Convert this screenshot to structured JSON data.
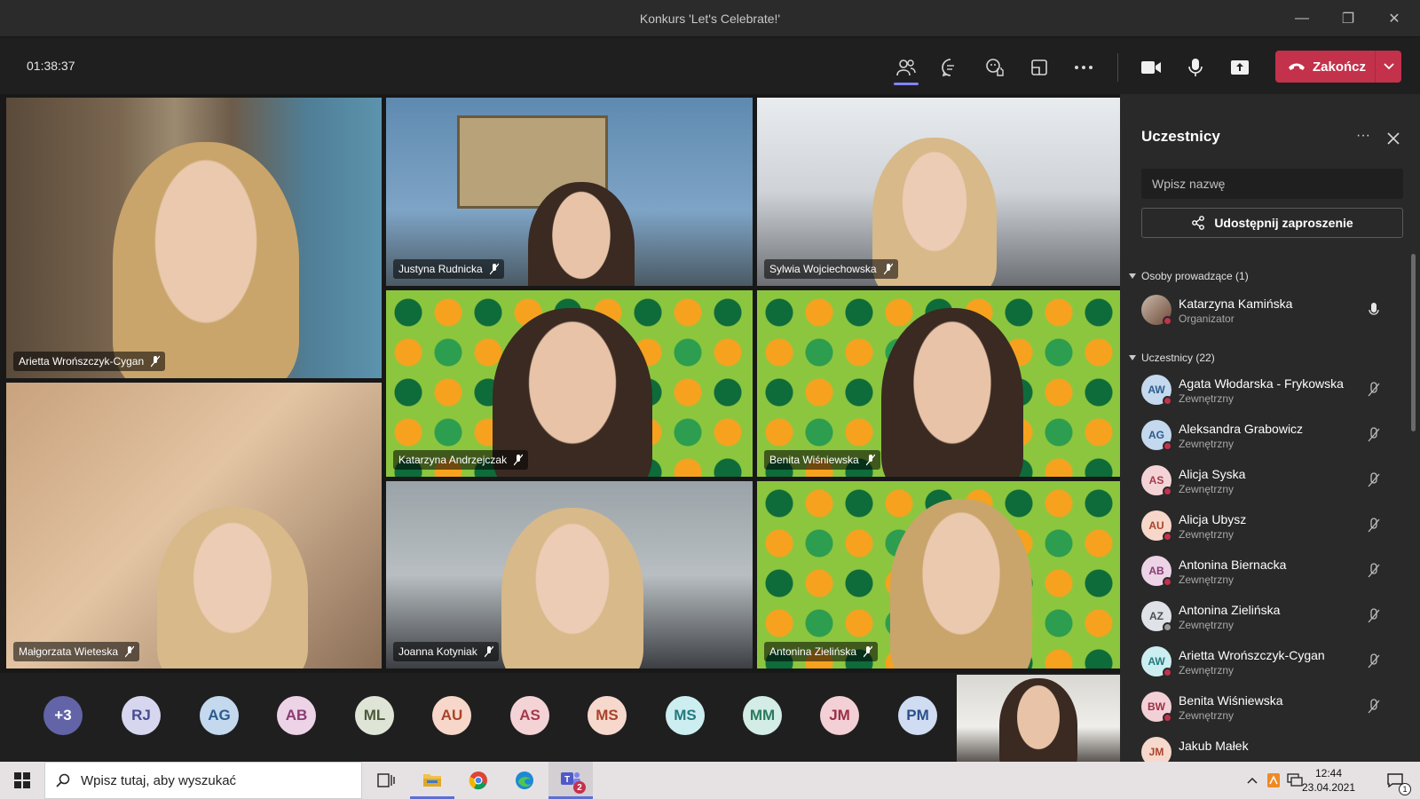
{
  "window": {
    "title": "Konkurs 'Let's Celebrate!'",
    "minimize": "—",
    "restore": "❐",
    "close": "✕"
  },
  "toolbar": {
    "timer": "01:38:37",
    "end_label": "Zakończ"
  },
  "tiles": [
    {
      "name": "Arietta Wrońszczyk-Cygan"
    },
    {
      "name": "Justyna Rudnicka"
    },
    {
      "name": "Sylwia Wojciechowska"
    },
    {
      "name": "Katarzyna Andrzejczak"
    },
    {
      "name": "Benita Wiśniewska"
    },
    {
      "name": "Małgorzata Wieteska"
    },
    {
      "name": "Joanna Kotyniak"
    },
    {
      "name": "Antonina Zielińska"
    }
  ],
  "strip": {
    "overflow": "+3",
    "avatars": [
      "RJ",
      "AG",
      "AB",
      "ML",
      "AU",
      "AS",
      "MS",
      "MS",
      "MM",
      "JM",
      "PM"
    ]
  },
  "panel": {
    "title": "Uczestnicy",
    "more": "···",
    "search_placeholder": "Wpisz nazwę",
    "share_label": "Udostępnij zaproszenie",
    "presenters_section": "Osoby prowadzące (1)",
    "attendees_section": "Uczestnicy (22)",
    "presenter": {
      "name": "Katarzyna Kamińska",
      "role": "Organizator"
    },
    "attendees": [
      {
        "initials": "AW",
        "name": "Agata Włodarska - Frykowska",
        "role": "Zewnętrzny"
      },
      {
        "initials": "AG",
        "name": "Aleksandra Grabowicz",
        "role": "Zewnętrzny"
      },
      {
        "initials": "AS",
        "name": "Alicja Syska",
        "role": "Zewnętrzny"
      },
      {
        "initials": "AU",
        "name": "Alicja Ubysz",
        "role": "Zewnętrzny"
      },
      {
        "initials": "AB",
        "name": "Antonina Biernacka",
        "role": "Zewnętrzny"
      },
      {
        "initials": "AZ",
        "name": "Antonina Zielińska",
        "role": "Zewnętrzny"
      },
      {
        "initials": "AW",
        "name": "Arietta Wrońszczyk-Cygan",
        "role": "Zewnętrzny"
      },
      {
        "initials": "BW",
        "name": "Benita Wiśniewska",
        "role": "Zewnętrzny"
      },
      {
        "initials": "JM",
        "name": "Jakub Małek",
        "role": ""
      }
    ]
  },
  "taskbar": {
    "search_placeholder": "Wpisz tutaj, aby wyszukać",
    "time": "12:44",
    "date": "23.04.2021",
    "teams_badge": "2",
    "notif_badge": "1"
  },
  "colors": {
    "accent": "#7f85f5",
    "end_call": "#c4314b",
    "panel_bg": "#292929",
    "taskbar_bg": "#e6e2e4"
  },
  "icons": [
    "people-icon",
    "chat-icon",
    "raise-hand-icon",
    "rooms-icon",
    "more-icon",
    "camera-icon",
    "mic-icon",
    "share-screen-icon",
    "phone-hangup-icon",
    "chevron-down-icon",
    "close-icon",
    "share-link-icon",
    "mic-off-icon",
    "windows-start-icon",
    "search-icon",
    "task-view-icon",
    "file-explorer-icon",
    "chrome-icon",
    "edge-icon",
    "teams-icon",
    "notification-icon"
  ]
}
